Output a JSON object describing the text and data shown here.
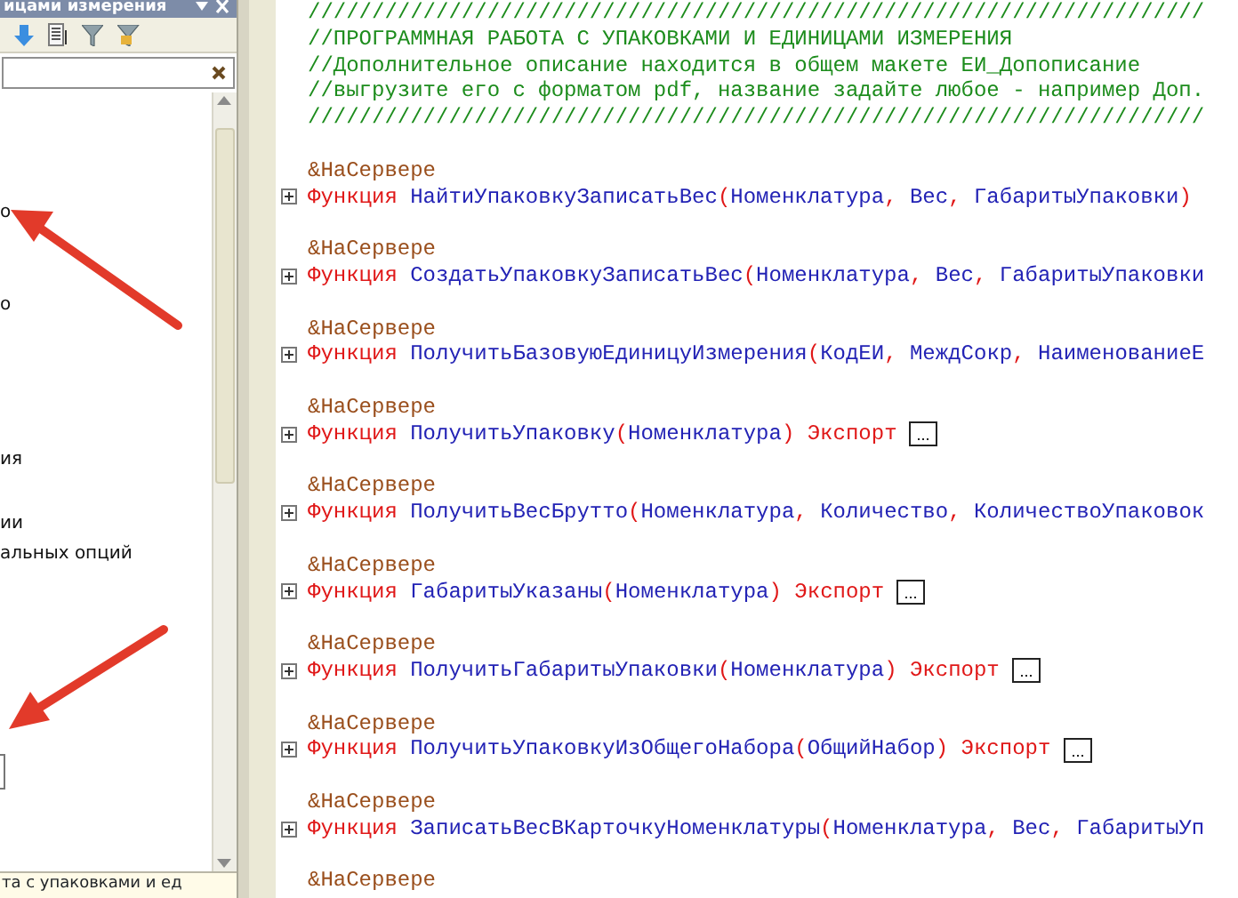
{
  "panel": {
    "title": "ицами измерения",
    "items": [
      {
        "label": "о"
      },
      {
        "label": "о"
      },
      {
        "label": "ия"
      },
      {
        "label": "ии"
      },
      {
        "label": "альных опций"
      }
    ],
    "status": "та с упаковками и ед"
  },
  "editor": {
    "lines": [
      {
        "kind": "comment",
        "text": "//////////////////////////////////////////////////////////////////////"
      },
      {
        "kind": "comment",
        "text": "//ПРОГРАММНАЯ РАБОТА С УПАКОВКАМИ И ЕДИНИЦАМИ ИЗМЕРЕНИЯ"
      },
      {
        "kind": "comment",
        "text": "//Дополнительное описание находится в общем макете ЕИ_Допописание"
      },
      {
        "kind": "comment",
        "text": "//выгрузите его с форматом pdf, название задайте любое - например Доп."
      },
      {
        "kind": "comment",
        "text": "//////////////////////////////////////////////////////////////////////"
      },
      {
        "kind": "blank"
      },
      {
        "kind": "directive",
        "text": "&НаСервере"
      },
      {
        "kind": "function",
        "expanded": false,
        "ellipsis_box": false,
        "tokens": [
          {
            "kind": "keyword",
            "text": "Функция "
          },
          {
            "kind": "name",
            "text": "НайтиУпаковкуЗаписатьВес"
          },
          {
            "kind": "punct",
            "text": "("
          },
          {
            "kind": "param",
            "text": "Номенклатура"
          },
          {
            "kind": "punct",
            "text": ", "
          },
          {
            "kind": "param",
            "text": "Вес"
          },
          {
            "kind": "punct",
            "text": ", "
          },
          {
            "kind": "param",
            "text": "ГабаритыУпаковки"
          },
          {
            "kind": "punct",
            "text": ")"
          }
        ]
      },
      {
        "kind": "blank"
      },
      {
        "kind": "directive",
        "text": "&НаСервере"
      },
      {
        "kind": "function",
        "expanded": false,
        "ellipsis_box": false,
        "tokens": [
          {
            "kind": "keyword",
            "text": "Функция "
          },
          {
            "kind": "name",
            "text": "СоздатьУпаковкуЗаписатьВес"
          },
          {
            "kind": "punct",
            "text": "("
          },
          {
            "kind": "param",
            "text": "Номенклатура"
          },
          {
            "kind": "punct",
            "text": ", "
          },
          {
            "kind": "param",
            "text": "Вес"
          },
          {
            "kind": "punct",
            "text": ", "
          },
          {
            "kind": "param",
            "text": "ГабаритыУпаковки"
          }
        ]
      },
      {
        "kind": "blank"
      },
      {
        "kind": "directive",
        "text": "&НаСервере"
      },
      {
        "kind": "function",
        "expanded": false,
        "ellipsis_box": false,
        "tokens": [
          {
            "kind": "keyword",
            "text": "Функция "
          },
          {
            "kind": "name",
            "text": "ПолучитьБазовуюЕдиницуИзмерения"
          },
          {
            "kind": "punct",
            "text": "("
          },
          {
            "kind": "param",
            "text": "КодЕИ"
          },
          {
            "kind": "punct",
            "text": ", "
          },
          {
            "kind": "param",
            "text": "МеждСокр"
          },
          {
            "kind": "punct",
            "text": ", "
          },
          {
            "kind": "param",
            "text": "НаименованиеЕ"
          }
        ]
      },
      {
        "kind": "blank"
      },
      {
        "kind": "directive",
        "text": "&НаСервере"
      },
      {
        "kind": "function",
        "expanded": false,
        "ellipsis_box": true,
        "tokens": [
          {
            "kind": "keyword",
            "text": "Функция "
          },
          {
            "kind": "name",
            "text": "ПолучитьУпаковку"
          },
          {
            "kind": "punct",
            "text": "("
          },
          {
            "kind": "param",
            "text": "Номенклатура"
          },
          {
            "kind": "punct",
            "text": ") "
          },
          {
            "kind": "export",
            "text": "Экспорт"
          }
        ]
      },
      {
        "kind": "blank"
      },
      {
        "kind": "directive",
        "text": "&НаСервере"
      },
      {
        "kind": "function",
        "expanded": false,
        "ellipsis_box": false,
        "tokens": [
          {
            "kind": "keyword",
            "text": "Функция "
          },
          {
            "kind": "name",
            "text": "ПолучитьВесБрутто"
          },
          {
            "kind": "punct",
            "text": "("
          },
          {
            "kind": "param",
            "text": "Номенклатура"
          },
          {
            "kind": "punct",
            "text": ", "
          },
          {
            "kind": "param",
            "text": "Количество"
          },
          {
            "kind": "punct",
            "text": ", "
          },
          {
            "kind": "param",
            "text": "КоличествоУпаковок"
          }
        ]
      },
      {
        "kind": "blank"
      },
      {
        "kind": "directive",
        "text": "&НаСервере"
      },
      {
        "kind": "function",
        "expanded": false,
        "ellipsis_box": true,
        "tokens": [
          {
            "kind": "keyword",
            "text": "Функция "
          },
          {
            "kind": "name",
            "text": "ГабаритыУказаны"
          },
          {
            "kind": "punct",
            "text": "("
          },
          {
            "kind": "param",
            "text": "Номенклатура"
          },
          {
            "kind": "punct",
            "text": ") "
          },
          {
            "kind": "export",
            "text": "Экспорт"
          }
        ]
      },
      {
        "kind": "blank"
      },
      {
        "kind": "directive",
        "text": "&НаСервере"
      },
      {
        "kind": "function",
        "expanded": false,
        "ellipsis_box": true,
        "tokens": [
          {
            "kind": "keyword",
            "text": "Функция "
          },
          {
            "kind": "name",
            "text": "ПолучитьГабаритыУпаковки"
          },
          {
            "kind": "punct",
            "text": "("
          },
          {
            "kind": "param",
            "text": "Номенклатура"
          },
          {
            "kind": "punct",
            "text": ") "
          },
          {
            "kind": "export",
            "text": "Экспорт"
          }
        ]
      },
      {
        "kind": "blank"
      },
      {
        "kind": "directive",
        "text": "&НаСервере"
      },
      {
        "kind": "function",
        "expanded": false,
        "ellipsis_box": true,
        "tokens": [
          {
            "kind": "keyword",
            "text": "Функция "
          },
          {
            "kind": "name",
            "text": "ПолучитьУпаковкуИзОбщегоНабора"
          },
          {
            "kind": "punct",
            "text": "("
          },
          {
            "kind": "param",
            "text": "ОбщийНабор"
          },
          {
            "kind": "punct",
            "text": ") "
          },
          {
            "kind": "export",
            "text": "Экспорт"
          }
        ]
      },
      {
        "kind": "blank"
      },
      {
        "kind": "directive",
        "text": "&НаСервере"
      },
      {
        "kind": "function",
        "expanded": false,
        "ellipsis_box": false,
        "tokens": [
          {
            "kind": "keyword",
            "text": "Функция "
          },
          {
            "kind": "name",
            "text": "ЗаписатьВесВКарточкуНоменклатуры"
          },
          {
            "kind": "punct",
            "text": "("
          },
          {
            "kind": "param",
            "text": "Номенклатура"
          },
          {
            "kind": "punct",
            "text": ", "
          },
          {
            "kind": "param",
            "text": "Вес"
          },
          {
            "kind": "punct",
            "text": ", "
          },
          {
            "kind": "param",
            "text": "ГабаритыУп"
          }
        ]
      },
      {
        "kind": "blank"
      },
      {
        "kind": "directive",
        "text": "&НаСервере"
      }
    ]
  }
}
